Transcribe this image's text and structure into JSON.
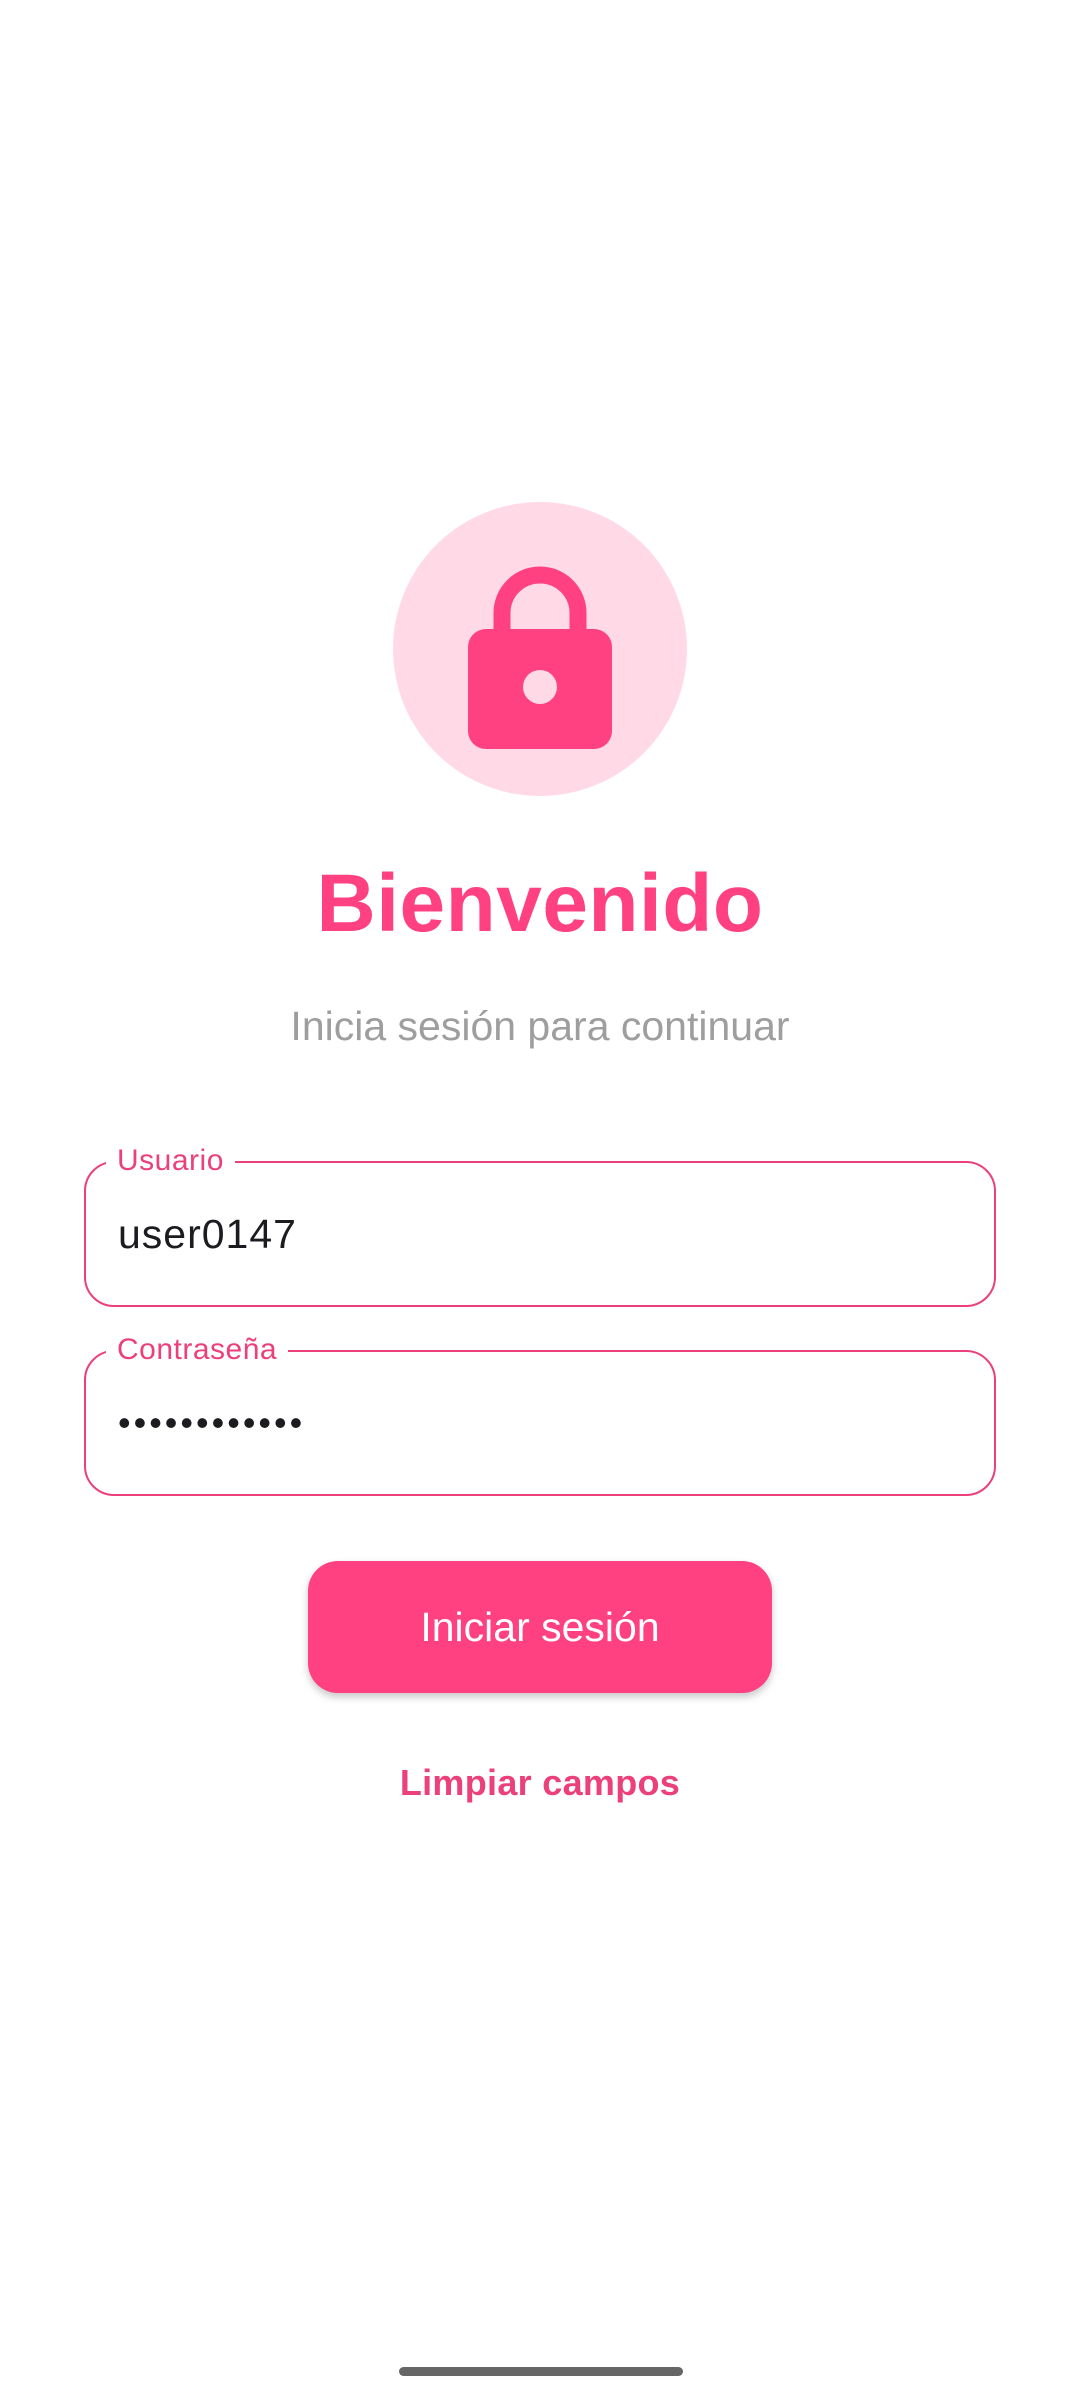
{
  "colors": {
    "accent": "#ff4081",
    "outline": "#ec407a",
    "icon_background": "#ffd9e6",
    "subtitle": "#9e9e9e",
    "background": "#ffffff"
  },
  "header": {
    "icon": "lock-icon",
    "title": "Bienvenido",
    "subtitle": "Inicia sesión para continuar"
  },
  "form": {
    "username": {
      "label": "Usuario",
      "value": "user0147"
    },
    "password": {
      "label": "Contraseña",
      "value": "••••••••••••"
    },
    "login_label": "Iniciar sesión",
    "clear_label": "Limpiar campos"
  }
}
